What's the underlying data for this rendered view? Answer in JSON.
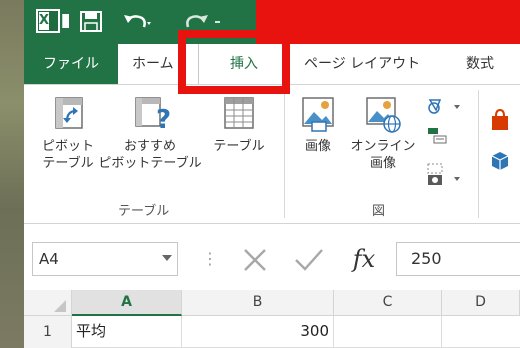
{
  "quick_access": {
    "app_icon": "excel-icon",
    "save_icon": "save-icon",
    "undo_icon": "undo-icon",
    "redo_icon": "redo-icon"
  },
  "tabs": {
    "file": "ファイル",
    "home": "ホーム",
    "insert": "挿入",
    "page_layout": "ページ レイアウト",
    "formulas": "数式"
  },
  "ribbon": {
    "pivot_table": [
      "ピボット",
      "テーブル"
    ],
    "recommended_pivot": [
      "おすすめ",
      "ピボットテーブル"
    ],
    "table": "テーブル",
    "pictures": "画像",
    "online_pictures": [
      "オンライン",
      "画像"
    ],
    "groups": {
      "tables": "テーブル",
      "illustrations": "図"
    }
  },
  "formula_bar": {
    "name_box": "A4",
    "cancel_icon": "cancel-icon",
    "enter_icon": "enter-icon",
    "fx_label": "fx",
    "value": "250"
  },
  "sheet": {
    "columns": [
      "A",
      "B",
      "C",
      "D"
    ],
    "rows": [
      {
        "row": "1",
        "a": "平均",
        "b": "300"
      }
    ]
  },
  "colors": {
    "excel_green": "#217346",
    "highlight_red": "#e8120e"
  }
}
